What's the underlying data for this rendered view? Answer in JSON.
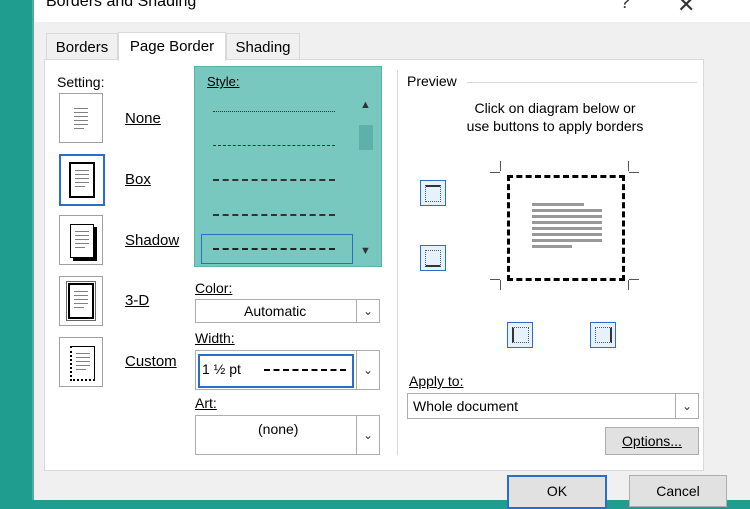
{
  "window": {
    "title": "Borders and Shading",
    "help_glyph": "?",
    "close_glyph": "✕"
  },
  "tabs": [
    {
      "label": "Borders",
      "active": false
    },
    {
      "label": "Page Border",
      "active": true
    },
    {
      "label": "Shading",
      "active": false
    }
  ],
  "setting": {
    "label": "Setting:",
    "items": [
      {
        "label": "None",
        "icon": "none-setting-icon"
      },
      {
        "label": "Box",
        "icon": "box-setting-icon",
        "selected": true
      },
      {
        "label": "Shadow",
        "icon": "shadow-setting-icon"
      },
      {
        "label": "3-D",
        "icon": "3d-setting-icon"
      },
      {
        "label": "Custom",
        "icon": "custom-setting-icon"
      }
    ]
  },
  "style": {
    "label": "Style:"
  },
  "color": {
    "label": "Color:",
    "value": "Automatic"
  },
  "width": {
    "label": "Width:",
    "value": "1 ½ pt"
  },
  "art": {
    "label": "Art:",
    "value": "(none)"
  },
  "preview": {
    "label": "Preview",
    "hint_line1": "Click on diagram below or",
    "hint_line2": "use buttons to apply borders"
  },
  "apply_to": {
    "label": "Apply to:",
    "value": "Whole document"
  },
  "buttons": {
    "options": "Options...",
    "ok": "OK",
    "cancel": "Cancel"
  },
  "colors": {
    "accent": "#2b6fc4",
    "highlight": "#78c8c0",
    "background": "#1f9e90"
  }
}
